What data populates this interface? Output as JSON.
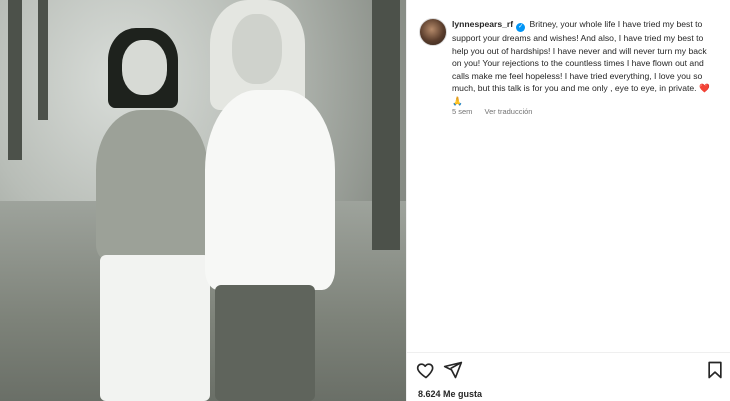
{
  "post": {
    "username": "lynnespears_rf",
    "caption": "Britney, your whole life I have tried my best to support your dreams and wishes! And also, I have tried my best to help you out of hardships! I have never and will never turn my back on you! Your rejections to the countless times I have flown out and calls make me feel hopeless! I have tried everything, I love you so much, but this talk is for you and me only , eye to eye, in private.",
    "emoji_heart": "❤️",
    "emoji_pray": "🙏",
    "time_ago": "5 sem",
    "translate_label": "Ver traducción",
    "likes_count": "8.624",
    "likes_label": "Me gusta"
  },
  "icons": [
    "heart-icon",
    "share-icon",
    "bookmark-icon",
    "verified-badge-icon"
  ],
  "colors": {
    "accent": "#0095f6",
    "text": "#262626",
    "muted": "#737373",
    "heart": "#e0245e"
  }
}
